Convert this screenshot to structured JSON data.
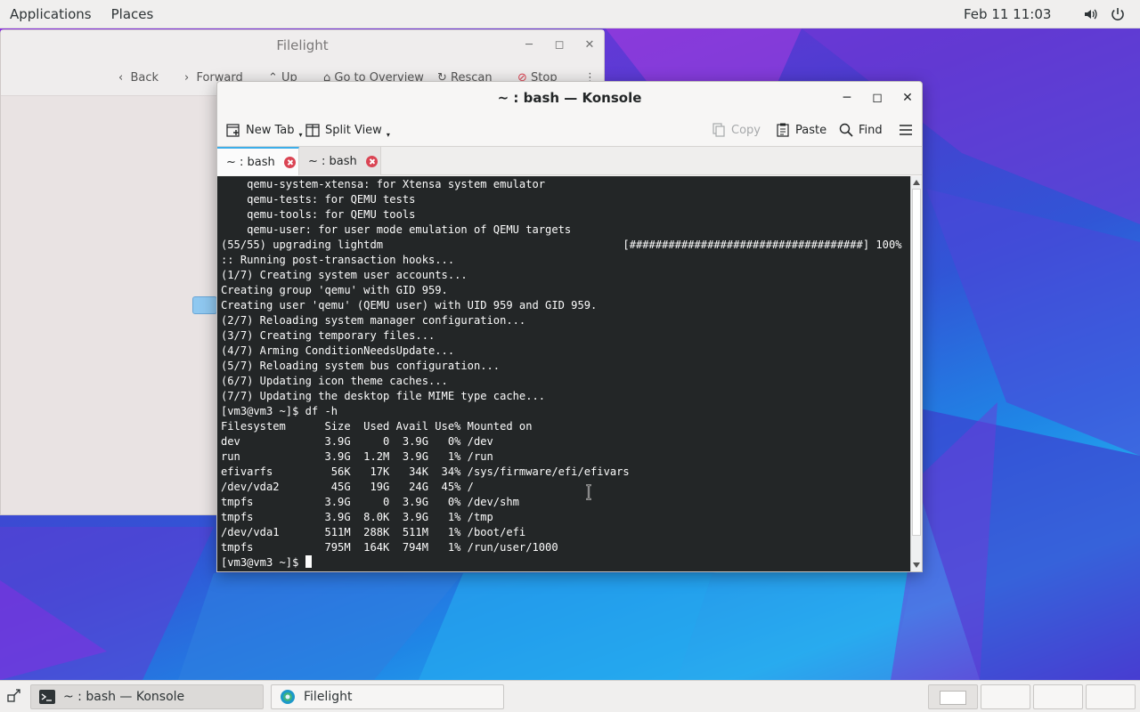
{
  "top_panel": {
    "applications": "Applications",
    "places": "Places",
    "clock": "Feb 11  11:03",
    "tray": [
      "volume-icon",
      "power-icon"
    ]
  },
  "filelight": {
    "title": "Filelight",
    "toolbar": {
      "back": "Back",
      "forward": "Forward",
      "up": "Up",
      "overview": "Go to Overview",
      "rescan": "Rescan",
      "stop": "Stop"
    }
  },
  "konsole": {
    "title": "~ : bash — Konsole",
    "toolbar": {
      "new_tab": "New Tab",
      "split_view": "Split View",
      "copy": "Copy",
      "paste": "Paste",
      "find": "Find"
    },
    "tabs": [
      {
        "label": "~ : bash",
        "active": true
      },
      {
        "label": "~ : bash",
        "active": false
      }
    ],
    "terminal_lines": [
      "    qemu-system-xtensa: for Xtensa system emulator",
      "    qemu-tests: for QEMU tests",
      "    qemu-tools: for QEMU tools",
      "    qemu-user: for user mode emulation of QEMU targets",
      "(55/55) upgrading lightdm                                     [####################################] 100%",
      ":: Running post-transaction hooks...",
      "(1/7) Creating system user accounts...",
      "Creating group 'qemu' with GID 959.",
      "Creating user 'qemu' (QEMU user) with UID 959 and GID 959.",
      "(2/7) Reloading system manager configuration...",
      "(3/7) Creating temporary files...",
      "(4/7) Arming ConditionNeedsUpdate...",
      "(5/7) Reloading system bus configuration...",
      "(6/7) Updating icon theme caches...",
      "(7/7) Updating the desktop file MIME type cache...",
      "[vm3@vm3 ~]$ df -h",
      "Filesystem      Size  Used Avail Use% Mounted on",
      "dev             3.9G     0  3.9G   0% /dev",
      "run             3.9G  1.2M  3.9G   1% /run",
      "efivarfs         56K   17K   34K  34% /sys/firmware/efi/efivars",
      "/dev/vda2        45G   19G   24G  45% /",
      "tmpfs           3.9G     0  3.9G   0% /dev/shm",
      "tmpfs           3.9G  8.0K  3.9G   1% /tmp",
      "/dev/vda1       511M  288K  511M   1% /boot/efi",
      "tmpfs           795M  164K  794M   1% /run/user/1000"
    ],
    "prompt": "[vm3@vm3 ~]$ "
  },
  "taskbar": {
    "tasks": [
      {
        "label": "~ : bash — Konsole",
        "icon": "terminal-icon",
        "active": true
      },
      {
        "label": "Filelight",
        "icon": "filelight-icon",
        "active": false
      }
    ],
    "workspaces": 4
  }
}
